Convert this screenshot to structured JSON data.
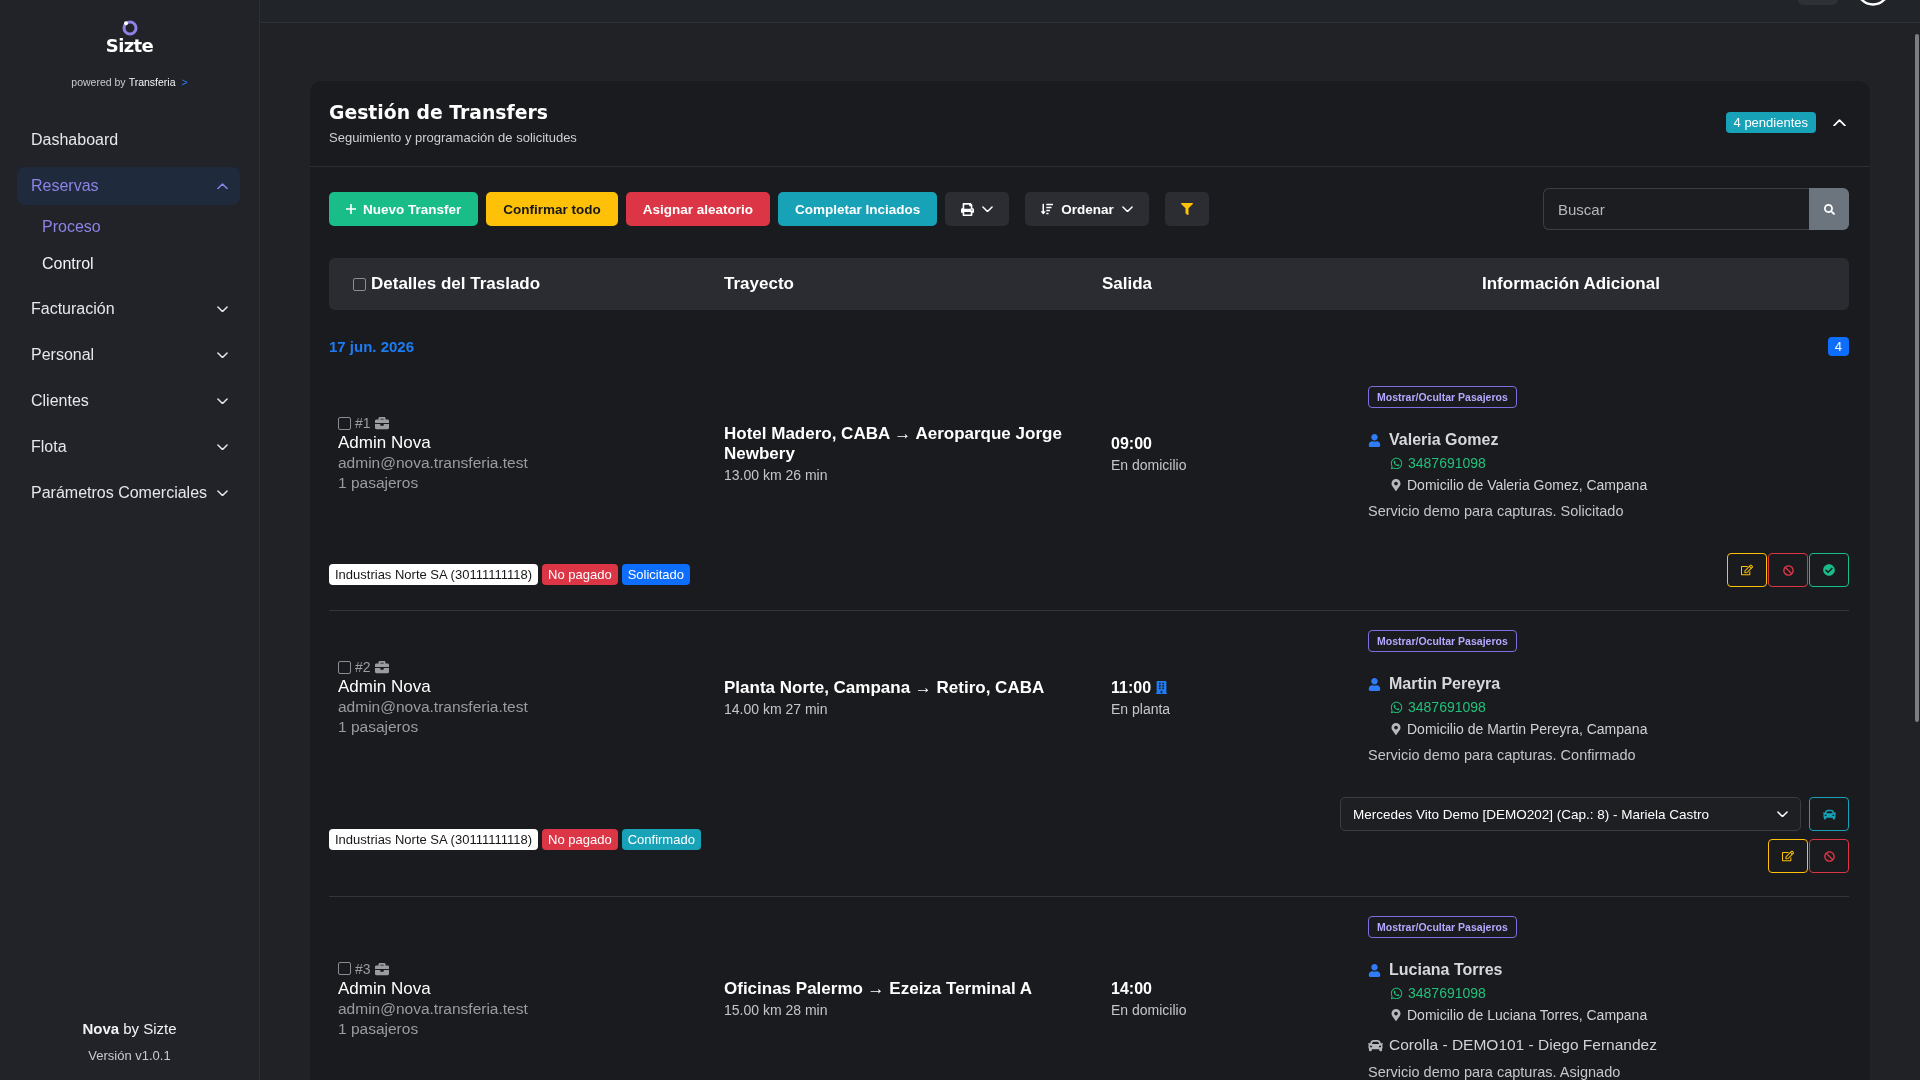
{
  "sidebar": {
    "brand": "Sizte",
    "powered_by": "powered by",
    "powered_brand": "Transferia",
    "powered_link": ">",
    "items": [
      {
        "kind": "link",
        "label": "Dashaboard",
        "selected": false
      },
      {
        "kind": "group",
        "label": "Reservas",
        "selected": true,
        "expanded": true,
        "children": [
          {
            "label": "Proceso",
            "selected": true
          },
          {
            "label": "Control",
            "selected": false
          }
        ]
      },
      {
        "kind": "group",
        "label": "Facturación",
        "selected": false,
        "expanded": false
      },
      {
        "kind": "group",
        "label": "Personal",
        "selected": false,
        "expanded": false
      },
      {
        "kind": "group",
        "label": "Clientes",
        "selected": false,
        "expanded": false
      },
      {
        "kind": "group",
        "label": "Flota",
        "selected": false,
        "expanded": false
      },
      {
        "kind": "group",
        "label": "Parámetros Comerciales",
        "selected": false,
        "expanded": false
      }
    ],
    "footer": {
      "product": "**Nova** by Sizte",
      "version": "Versión v1.0.1"
    }
  },
  "panel": {
    "title": "Gestión de Transfers",
    "subtitle": "Seguimiento y programación de solicitudes",
    "badge": "4 pendientes",
    "expanded": true
  },
  "toolbar": {
    "buttons": [
      {
        "kind": "add",
        "label": "Nuevo Transfer",
        "color": "#19bd88"
      },
      {
        "kind": "plain",
        "label": "Confirmar todo",
        "color": "#ffc107"
      },
      {
        "kind": "plain",
        "label": "Asignar aleatorio",
        "color": "#dc3545"
      },
      {
        "kind": "plain",
        "label": "Completar Inciados",
        "color": "#17a2b8"
      },
      {
        "kind": "print"
      },
      {
        "kind": "sort",
        "label": "Ordenar"
      },
      {
        "kind": "filter"
      }
    ]
  },
  "search": {
    "placeholder": "Buscar"
  },
  "table": {
    "select_all": {
      "checked": false
    },
    "columns": [
      "Detalles del Traslado",
      "Trayecto",
      "Salida",
      "Información Adicional"
    ],
    "groups": [
      {
        "date": "17 jun. 2026",
        "count": "4",
        "rows": [
          {
            "number": "#1",
            "checked": false,
            "creator": "Admin Nova",
            "email": "admin@nova.transferia.test",
            "passengers": "1 pasajeros",
            "route": "Hotel Madero, CABA → Aeroparque Jorge Newbery",
            "trip": "13.00 km 26 min",
            "departure": {
              "kind": "home",
              "time": "09:00",
              "place": "En domicilio"
            },
            "toggle": "Mostrar/Ocultar Pasajeros",
            "passenger": {
              "name": "Valeria Gomez",
              "phone": "3487691098",
              "address": "Domicilio de Valeria Gomez, Campana"
            },
            "note": "Servicio demo para capturas. Solicitado",
            "tags": [
              {
                "label": "Industrias Norte SA (30111111118)",
                "color": "#ffffff"
              },
              {
                "label": "No pagado",
                "color": "#dc3545"
              },
              {
                "label": "Solicitado",
                "color": "#0d6efd"
              }
            ],
            "actions": [
              {
                "kind": "edit"
              },
              {
                "kind": "cancel"
              },
              {
                "kind": "confirm"
              }
            ]
          },
          {
            "number": "#2",
            "checked": false,
            "creator": "Admin Nova",
            "email": "admin@nova.transferia.test",
            "passengers": "1 pasajeros",
            "route": "Planta Norte, Campana → Retiro, CABA",
            "trip": "14.00 km 27 min",
            "departure": {
              "kind": "plant",
              "time": "11:00",
              "place": "En planta"
            },
            "toggle": "Mostrar/Ocultar Pasajeros",
            "passenger": {
              "name": "Martin Pereyra",
              "phone": "3487691098",
              "address": "Domicilio de Martin Pereyra, Campana"
            },
            "note": "Servicio demo para capturas. Confirmado",
            "vehicle": {
              "kind": "select",
              "value": "Mercedes Vito Demo [DEMO202] (Cap.: 8) - Mariela Castro"
            },
            "tags": [
              {
                "label": "Industrias Norte SA (30111111118)",
                "color": "#ffffff"
              },
              {
                "label": "No pagado",
                "color": "#dc3545"
              },
              {
                "label": "Confirmado",
                "color": "#17a2b8"
              }
            ],
            "actions": [
              {
                "kind": "edit"
              },
              {
                "kind": "cancel"
              }
            ]
          },
          {
            "number": "#3",
            "checked": false,
            "creator": "Admin Nova",
            "email": "admin@nova.transferia.test",
            "passengers": "1 pasajeros",
            "route": "Oficinas Palermo → Ezeiza Terminal A",
            "trip": "15.00 km 28 min",
            "departure": {
              "kind": "home",
              "time": "14:00",
              "place": "En domicilio"
            },
            "toggle": "Mostrar/Ocultar Pasajeros",
            "passenger": {
              "name": "Luciana Torres",
              "phone": "3487691098",
              "address": "Domicilio de Luciana Torres, Campana"
            },
            "vehicle": {
              "kind": "assigned",
              "value": "Corolla - DEMO101 - Diego Fernandez"
            },
            "note": "Servicio demo para capturas. Asignado"
          }
        ]
      }
    ]
  }
}
